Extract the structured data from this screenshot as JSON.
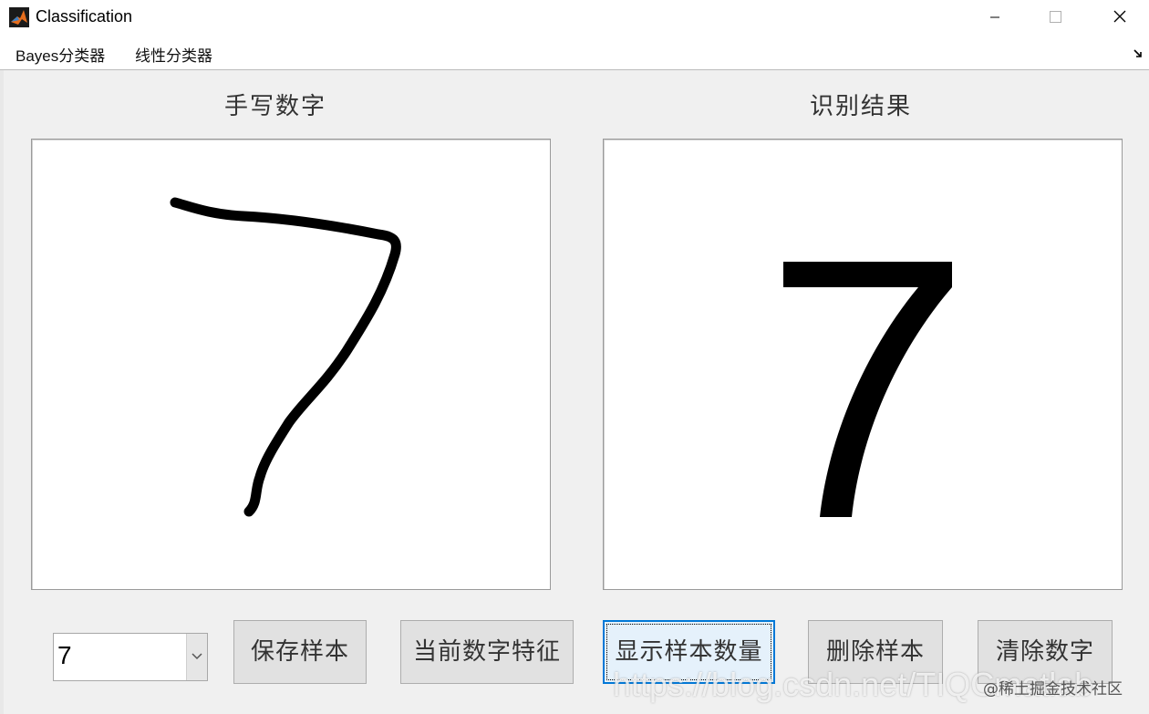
{
  "window": {
    "title": "Classification"
  },
  "menubar": {
    "items": [
      "Bayes分类器",
      "线性分类器"
    ]
  },
  "panels": {
    "left_title": "手写数字",
    "right_title": "识别结果",
    "recognized_digit": "7"
  },
  "controls": {
    "digit_select": "7",
    "buttons": [
      "保存样本",
      "当前数字特征",
      "显示样本数量",
      "删除样本",
      "清除数字"
    ]
  },
  "watermark": {
    "url": "https://blog.csdn.net/TIQCmatlab",
    "site": "@稀土掘金技术社区"
  },
  "colors": {
    "accent": "#0078d7",
    "background": "#f0f0f0"
  }
}
